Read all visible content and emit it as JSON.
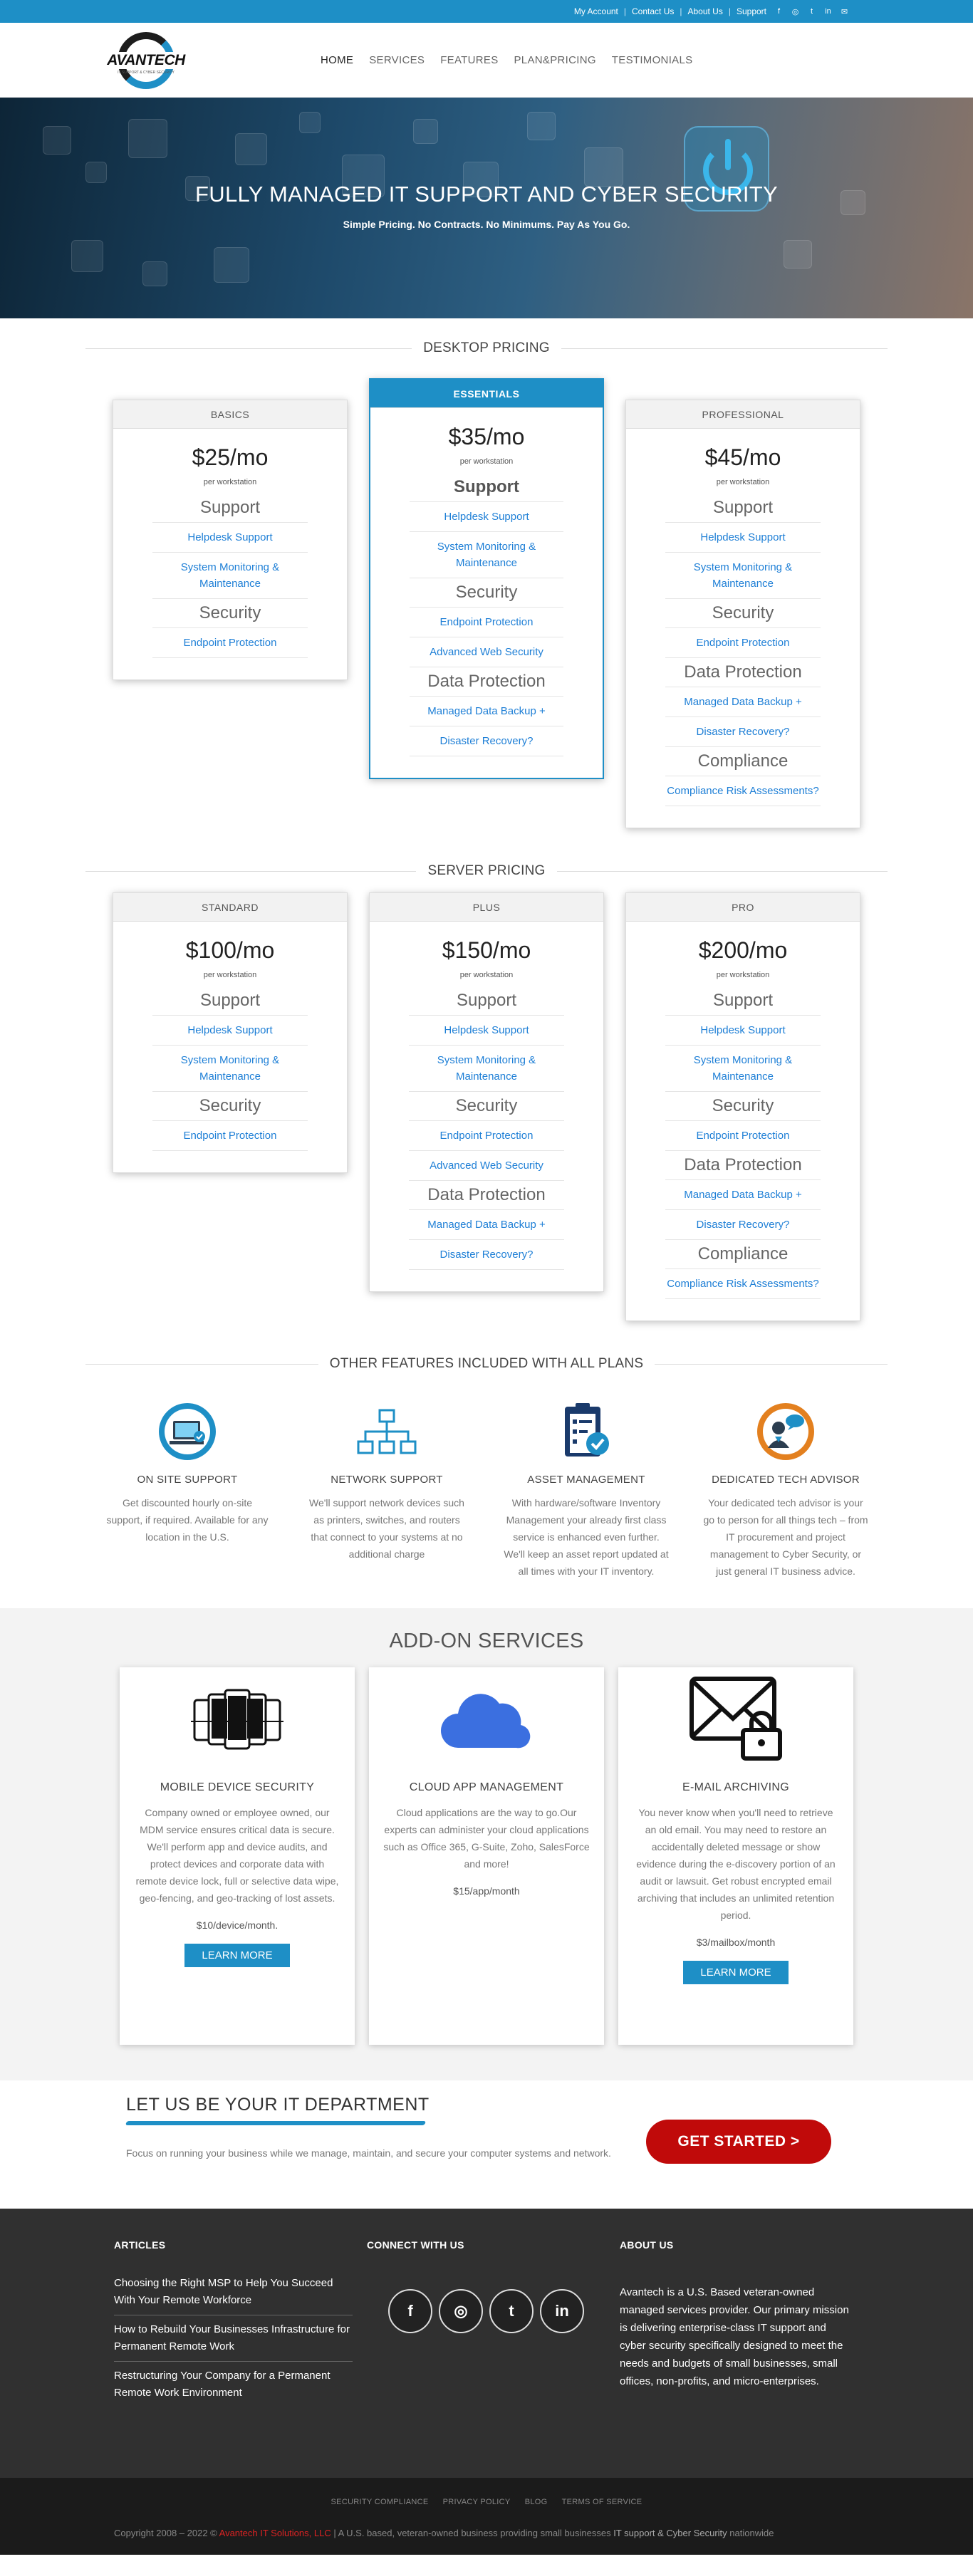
{
  "topbar": {
    "links": [
      "My Account",
      "Contact Us",
      "About Us",
      "Support"
    ],
    "social_icons": [
      "facebook-icon",
      "instagram-icon",
      "twitter-icon",
      "linkedin-icon",
      "email-icon"
    ]
  },
  "header": {
    "logo_text": "AVANTECH",
    "logo_tagline": "IT SUPPORT & CYBER SECURITY",
    "nav": [
      "HOME",
      "SERVICES",
      "FEATURES",
      "PLAN&PRICING",
      "TESTIMONIALS"
    ],
    "active_nav": "HOME"
  },
  "hero": {
    "title": "FULLY MANAGED IT SUPPORT AND CYBER SECURITY",
    "subtitle": "Simple Pricing. No Contracts. No Minimums. Pay As You Go."
  },
  "desktop": {
    "section_title": "DESKTOP PRICING",
    "plans": [
      {
        "name": "BASICS",
        "price": "$25/mo",
        "per": "per workstation",
        "groups": [
          {
            "title": "Support",
            "items": [
              "Helpdesk Support",
              "System Monitoring & Maintenance"
            ]
          },
          {
            "title": "Security",
            "items": [
              "Endpoint Protection"
            ]
          }
        ]
      },
      {
        "name": "ESSENTIALS",
        "price": "$35/mo",
        "per": "per workstation",
        "groups": [
          {
            "title": "Support",
            "items": [
              "Helpdesk Support",
              "System Monitoring & Maintenance"
            ]
          },
          {
            "title": "Security",
            "items": [
              "Endpoint Protection",
              "Advanced Web Security"
            ]
          },
          {
            "title": "Data Protection",
            "items": [
              "Managed Data Backup +",
              "Disaster Recovery?"
            ]
          }
        ]
      },
      {
        "name": "PROFESSIONAL",
        "price": "$45/mo",
        "per": "per workstation",
        "groups": [
          {
            "title": "Support",
            "items": [
              "Helpdesk Support",
              "System Monitoring & Maintenance"
            ]
          },
          {
            "title": "Security",
            "items": [
              "Endpoint Protection"
            ]
          },
          {
            "title": "Data Protection",
            "items": [
              "Managed Data Backup +",
              "Disaster Recovery?"
            ]
          },
          {
            "title": "Compliance",
            "items": [
              "Compliance Risk Assessments?"
            ]
          }
        ]
      }
    ]
  },
  "server": {
    "section_title": "SERVER PRICING",
    "plans": [
      {
        "name": "STANDARD",
        "price": "$100/mo",
        "per": "per workstation",
        "groups": [
          {
            "title": "Support",
            "items": [
              "Helpdesk Support",
              "System Monitoring & Maintenance"
            ]
          },
          {
            "title": "Security",
            "items": [
              "Endpoint Protection"
            ]
          }
        ]
      },
      {
        "name": "PLUS",
        "price": "$150/mo",
        "per": "per workstation",
        "groups": [
          {
            "title": "Support",
            "items": [
              "Helpdesk Support",
              "System Monitoring & Maintenance"
            ]
          },
          {
            "title": "Security",
            "items": [
              "Endpoint Protection",
              "Advanced Web Security"
            ]
          },
          {
            "title": "Data Protection",
            "items": [
              "Managed Data Backup +",
              "Disaster Recovery?"
            ]
          }
        ]
      },
      {
        "name": "PRO",
        "price": "$200/mo",
        "per": "per workstation",
        "groups": [
          {
            "title": "Support",
            "items": [
              "Helpdesk Support",
              "System Monitoring & Maintenance"
            ]
          },
          {
            "title": "Security",
            "items": [
              "Endpoint Protection"
            ]
          },
          {
            "title": "Data Protection",
            "items": [
              "Managed Data Backup +",
              "Disaster Recovery?"
            ]
          },
          {
            "title": "Compliance",
            "items": [
              "Compliance Risk Assessments?"
            ]
          }
        ]
      }
    ]
  },
  "features": {
    "section_title": "OTHER FEATURES INCLUDED WITH ALL PLANS",
    "items": [
      {
        "icon": "onsite-support-icon",
        "title": "ON SITE SUPPORT",
        "text": "Get discounted hourly on-site support, if required. Available for any location in the U.S."
      },
      {
        "icon": "network-icon",
        "title": "NETWORK SUPPORT",
        "text": "We'll support network devices such as printers, switches, and routers that connect to your systems at no additional charge"
      },
      {
        "icon": "clipboard-check-icon",
        "title": "ASSET MANAGEMENT",
        "text": "With hardware/software Inventory Management your already first class service is enhanced even further. We'll keep an asset report updated at all times with your IT inventory."
      },
      {
        "icon": "tech-advisor-icon",
        "title": "DEDICATED TECH ADVISOR",
        "text": "Your dedicated tech advisor is your go to person for all things tech – from IT procurement and project management to Cyber Security, or just general IT business advice."
      }
    ]
  },
  "addons": {
    "title": "ADD-ON SERVICES",
    "items": [
      {
        "icon": "mobile-devices-icon",
        "title": "MOBILE DEVICE SECURITY",
        "text": "Company owned or employee owned, our MDM service ensures critical data is secure. We'll perform app and device audits, and protect devices and corporate data with remote device lock, full or selective data wipe, geo-fencing, and geo-tracking of lost assets.",
        "price": "$10/device/month.",
        "button": "LEARN MORE"
      },
      {
        "icon": "cloud-icon",
        "title": "CLOUD APP MANAGEMENT",
        "text": "Cloud applications are the way to go.Our experts can administer your cloud applications such as Office 365, G-Suite, Zoho, SalesForce and more!",
        "price": "$15/app/month",
        "button": ""
      },
      {
        "icon": "email-lock-icon",
        "title": "E-MAIL ARCHIVING",
        "text": "You never know when you'll need to retrieve an old email. You may need to restore an accidentally deleted message or show evidence during the e-discovery portion of an audit or lawsuit. Get robust encrypted email archiving that includes an unlimited retention period.",
        "price": "$3/mailbox/month",
        "button": "LEARN MORE"
      }
    ]
  },
  "cta": {
    "title": "LET US BE YOUR IT DEPARTMENT",
    "text": "Focus on running your business while we manage, maintain, and secure your computer systems and network.",
    "button": "GET STARTED >"
  },
  "footer": {
    "articles_title": "ARTICLES",
    "articles": [
      "Choosing the Right MSP to Help You Succeed With Your Remote Workforce",
      "How to Rebuild Your Businesses Infrastructure for Permanent Remote Work",
      "Restructuring Your Company for a Permanent Remote Work Environment"
    ],
    "connect_title": "CONNECT WITH US",
    "connect_icons": [
      "facebook-icon",
      "instagram-icon",
      "twitter-icon",
      "linkedin-icon"
    ],
    "about_title": "ABOUT US",
    "about_text": "Avantech is a U.S. Based veteran-owned managed services provider. Our primary mission is delivering enterprise-class IT support and cyber security specifically designed to meet the needs and budgets of small businesses, small offices, non-profits, and micro-enterprises."
  },
  "bottom": {
    "links": [
      "SECURITY COMPLIANCE",
      "PRIVACY POLICY",
      "BLOG",
      "TERMS OF SERVICE"
    ],
    "copyright_prefix": "Copyright 2008 – 2022 ©",
    "company": "Avantech IT Solutions, LLC",
    "copyright_mid": "| A U.S. based, veteran-owned business providing small businesses",
    "highlight": "IT support & Cyber Security",
    "copyright_suffix": "nationwide"
  },
  "colors": {
    "accent": "#1e8fc6",
    "cta": "#c00a0a",
    "link": "#1e7fd6"
  }
}
